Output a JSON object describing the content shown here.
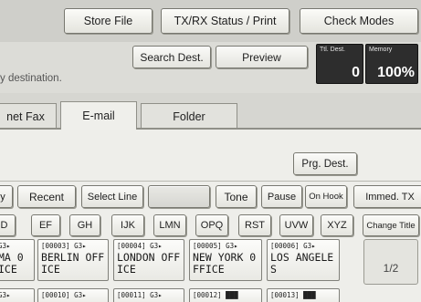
{
  "toolbar": {
    "store_file": "Store File",
    "txrx_status": "TX/RX Status / Print",
    "check_modes": "Check Modes"
  },
  "dest_bar": {
    "search_dest": "Search Dest.",
    "preview": "Preview",
    "prompt_text": "y destination.",
    "tx_dest_label": "Ttl. Dest.",
    "tx_dest_value": "0",
    "memory_label": "Memory",
    "memory_value": "100%"
  },
  "tabs": [
    {
      "label": "net Fax"
    },
    {
      "label": "E-mail"
    },
    {
      "label": "Folder"
    }
  ],
  "prg_dest": "Prg. Dest.",
  "function_keys": {
    "partial_left": "y",
    "recent": "Recent",
    "select_line": "Select Line",
    "blank": "",
    "tone": "Tone",
    "pause": "Pause",
    "on_hook": "On Hook",
    "immed_tx": "Immed. TX"
  },
  "title_keys": [
    "D",
    "EF",
    "GH",
    "IJK",
    "LMN",
    "OPQ",
    "RST",
    "UVW",
    "XYZ",
    "Change Title"
  ],
  "destinations": [
    {
      "num": "G3▸",
      "name": "MA 0\nICE"
    },
    {
      "num": "[00003] G3▸",
      "name": "BERLIN OFF\nICE"
    },
    {
      "num": "[00004] G3▸",
      "name": "LONDON OFF\nICE"
    },
    {
      "num": "[00005] G3▸",
      "name": "NEW YORK 0\nFFICE"
    },
    {
      "num": "[00006] G3▸",
      "name": "LOS ANGELE\nS"
    }
  ],
  "destinations_row2": [
    {
      "num": "G3▸"
    },
    {
      "num": "[00010] G3▸"
    },
    {
      "num": "[00011] G3▸"
    },
    {
      "num": "[00012] ███"
    },
    {
      "num": "[00013] ███"
    }
  ],
  "pager": {
    "page": "1/2"
  }
}
